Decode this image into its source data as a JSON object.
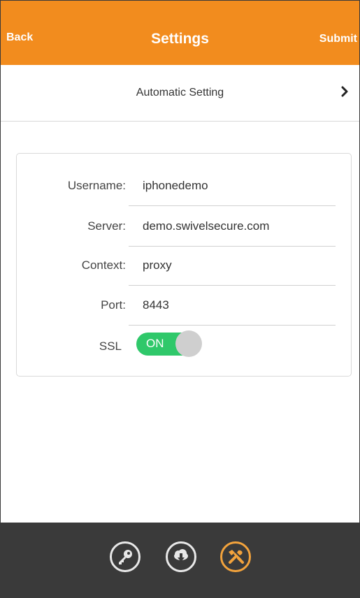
{
  "header": {
    "back_label": "Back",
    "title": "Settings",
    "submit_label": "Submit",
    "accent_color": "#f28c1e"
  },
  "automatic_setting": {
    "label": "Automatic Setting",
    "icon": "chevron-right-icon"
  },
  "form": {
    "fields": [
      {
        "label": "Username:",
        "value": "iphonedemo"
      },
      {
        "label": "Server:",
        "value": "demo.swivelsecure.com"
      },
      {
        "label": "Context:",
        "value": "proxy"
      },
      {
        "label": "Port:",
        "value": "8443"
      }
    ],
    "ssl": {
      "label": "SSL",
      "state_label": "ON",
      "on": true,
      "color": "#2fc86a"
    }
  },
  "footer": {
    "tabs": [
      {
        "icon": "key-icon",
        "active": false
      },
      {
        "icon": "cloud-download-icon",
        "active": false
      },
      {
        "icon": "tools-icon",
        "active": true
      }
    ],
    "active_color": "#f3a33c"
  }
}
